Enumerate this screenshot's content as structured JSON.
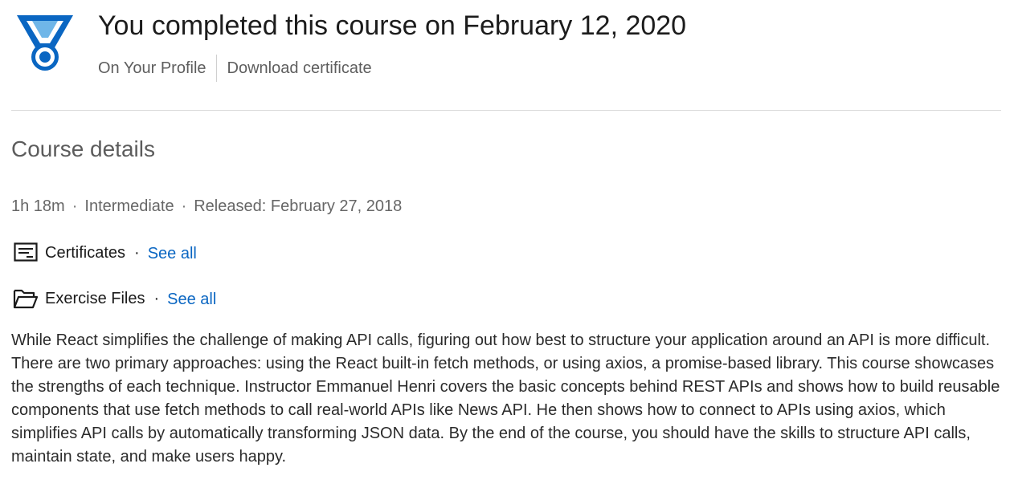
{
  "completion": {
    "title": "You completed this course on February 12, 2020",
    "links": {
      "profile": "On Your Profile",
      "download": "Download certificate"
    },
    "medal_icon": "medal-icon",
    "accent_color": "#0a66c2"
  },
  "course_details": {
    "heading": "Course details",
    "meta": {
      "duration": "1h 18m",
      "level": "Intermediate",
      "released": "Released: February 27, 2018",
      "separator": "·"
    },
    "certificates": {
      "icon": "certificate-icon",
      "label": "Certificates",
      "separator": "·",
      "see_all": "See all"
    },
    "exercise_files": {
      "icon": "folder-icon",
      "label": "Exercise Files",
      "separator": "·",
      "see_all": "See all"
    },
    "description": "While React simplifies the challenge of making API calls, figuring out how best to structure your application around an API is more difficult. There are two primary approaches: using the React built-in fetch methods, or using axios, a promise-based library. This course showcases the strengths of each technique. Instructor Emmanuel Henri covers the basic concepts behind REST APIs and shows how to build reusable components that use fetch methods to call real-world APIs like News API. He then shows how to connect to APIs using axios, which simplifies API calls by automatically transforming JSON data. By the end of the course, you should have the skills to structure API calls, maintain state, and make users happy."
  },
  "colors": {
    "link": "#0a66c2",
    "medal": "#0a66c2",
    "text": "#1f1f1f",
    "muted": "#666666"
  }
}
